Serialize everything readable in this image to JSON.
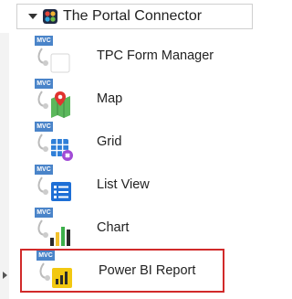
{
  "category": {
    "title": "The Portal Connector",
    "caret_icon": "caret-down-icon",
    "icon": "portal-connector-logo-icon"
  },
  "widgets": [
    {
      "label": "TPC Form Manager",
      "badge": "MVC",
      "icon": "form-manager-icon"
    },
    {
      "label": "Map",
      "badge": "MVC",
      "icon": "map-icon"
    },
    {
      "label": "Grid",
      "badge": "MVC",
      "icon": "grid-icon"
    },
    {
      "label": "List View",
      "badge": "MVC",
      "icon": "list-view-icon"
    },
    {
      "label": "Chart",
      "badge": "MVC",
      "icon": "chart-icon"
    },
    {
      "label": "Power BI Report",
      "badge": "MVC",
      "icon": "power-bi-icon",
      "selected": true
    }
  ],
  "colors": {
    "selection_border": "#d12a2a",
    "mvc_badge": "#4a84c9"
  }
}
